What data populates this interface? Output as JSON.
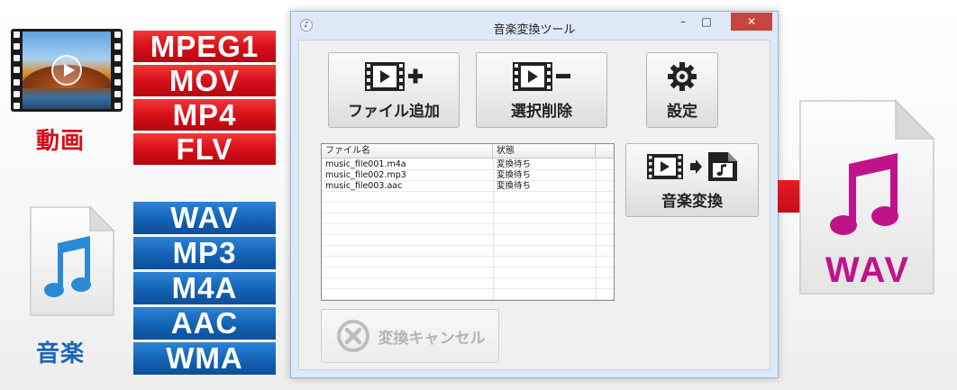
{
  "video_category": {
    "label": "動画",
    "formats": [
      "MPEG1",
      "MOV",
      "MP4",
      "FLV"
    ]
  },
  "audio_category": {
    "label": "音楽",
    "formats": [
      "WAV",
      "MP3",
      "M4A",
      "AAC",
      "WMA"
    ]
  },
  "window": {
    "title": "音楽変換ツール",
    "controls": {
      "minimize": "–",
      "maximize": "□",
      "close": "✕"
    }
  },
  "toolbar": {
    "add_label": "ファイル追加",
    "delete_label": "選択削除",
    "settings_label": "設定",
    "convert_label": "音楽変換",
    "cancel_label": "変換キャンセル"
  },
  "file_list": {
    "columns": [
      "ファイル名",
      "状態"
    ],
    "rows": [
      {
        "name": "music_file001.m4a",
        "status": "変換待ち"
      },
      {
        "name": "music_file002.mp3",
        "status": "変換待ち"
      },
      {
        "name": "music_file003.aac",
        "status": "変換待ち"
      }
    ]
  },
  "output": {
    "format": "WAV"
  },
  "colors": {
    "video_red": "#d8101a",
    "audio_blue": "#1565b8",
    "music_magenta": "#c0138a",
    "note_blue": "#2a8ad8"
  },
  "icons": [
    "film-play-icon",
    "music-note-icon",
    "film-add-icon",
    "film-remove-icon",
    "gear-icon",
    "film-to-audio-icon",
    "cancel-circle-icon",
    "arrow-right-icon"
  ]
}
